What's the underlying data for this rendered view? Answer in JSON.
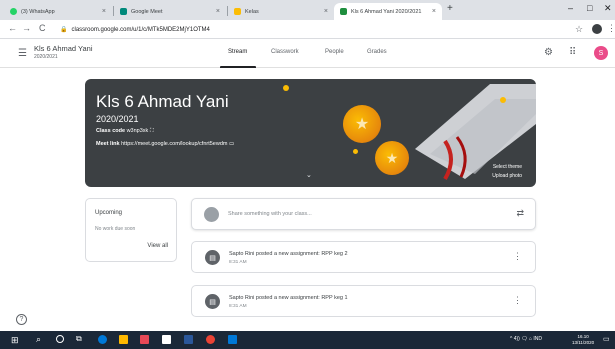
{
  "browser": {
    "tabs": [
      {
        "title": "(3) WhatsApp",
        "favicon_color": "#25d366"
      },
      {
        "title": "Google Meet",
        "favicon_color": "#00897b"
      },
      {
        "title": "Kelas",
        "favicon_color": "#fbbc04"
      },
      {
        "title": "Kls 6 Ahmad Yani 2020/2021",
        "favicon_color": "#1e8e3e"
      }
    ],
    "new_tab_label": "+",
    "url": "classroom.google.com/u/1/c/MTk5MDE2MjY1OTM4",
    "window_controls": [
      "–",
      "□",
      "✕"
    ]
  },
  "header": {
    "class_name": "Kls 6 Ahmad Yani",
    "class_section": "2020/2021",
    "tabs": [
      {
        "label": "Stream",
        "active": true
      },
      {
        "label": "Classwork",
        "active": false
      },
      {
        "label": "People",
        "active": false
      },
      {
        "label": "Grades",
        "active": false
      }
    ],
    "avatar_letter": "S"
  },
  "banner": {
    "title": "Kls 6 Ahmad Yani",
    "year": "2020/2021",
    "class_code_label": "Class code",
    "class_code": "w3np3xk",
    "meet_link_label": "Meet link",
    "meet_link": "https://meet.google.com/lookup/cfnrt5ewdm",
    "select_theme": "Select theme",
    "upload_photo": "Upload photo",
    "bg_color": "#3c4043"
  },
  "upcoming": {
    "title": "Upcoming",
    "empty_text": "No work due soon",
    "view_all": "View all"
  },
  "share": {
    "placeholder": "Share something with your class..."
  },
  "posts": [
    {
      "title": "Sapto Rini posted a new assignment: RPP keg 2",
      "time": "8:31 AM"
    },
    {
      "title": "Sapto Rini posted a new assignment: RPP keg 1",
      "time": "8:31 AM"
    }
  ],
  "taskbar": {
    "tray_text": "^ 4)) 🗨 ⌂ IND",
    "time": "16.10",
    "date": "13/11/2020"
  }
}
